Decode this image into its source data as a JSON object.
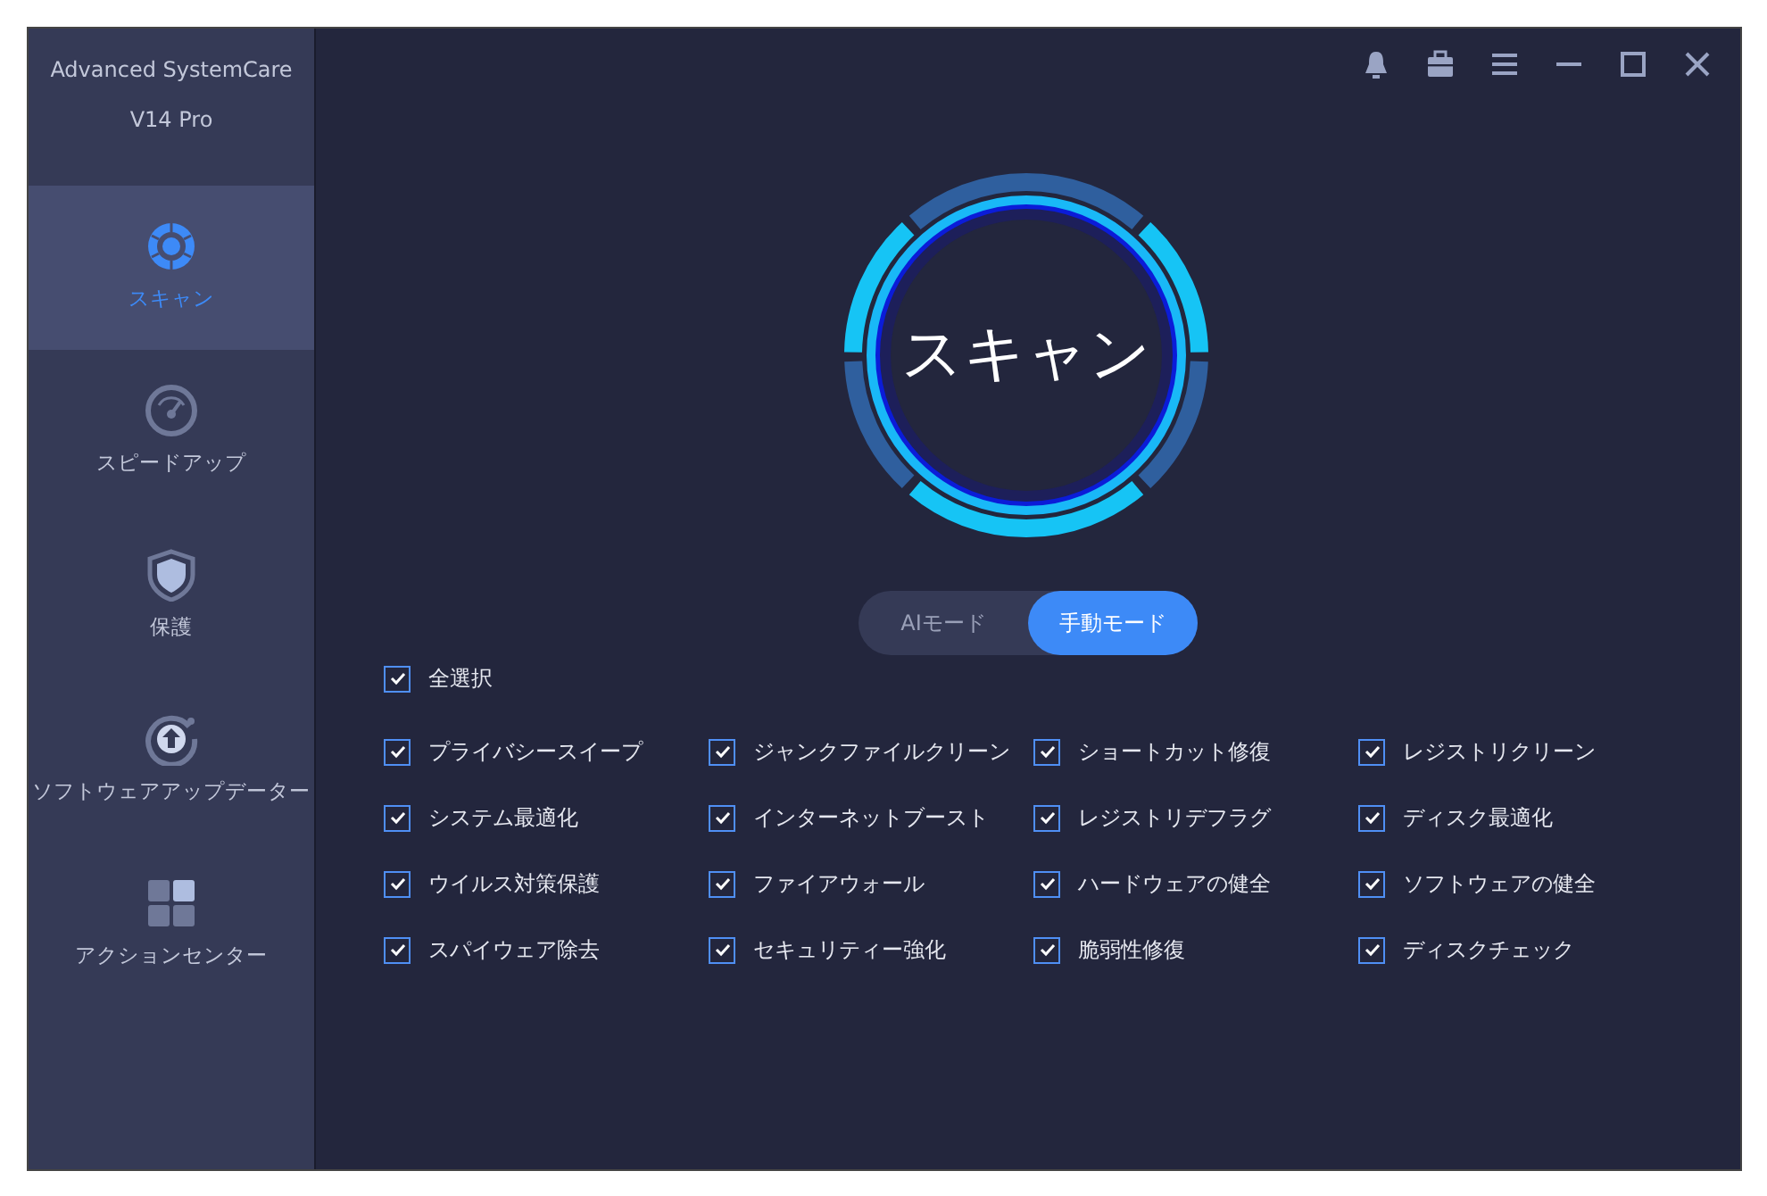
{
  "app": {
    "title": "Advanced SystemCare",
    "version": "V14 Pro"
  },
  "sidebar": {
    "items": [
      {
        "label": "スキャン",
        "selected": true
      },
      {
        "label": "スピードアップ",
        "selected": false
      },
      {
        "label": "保護",
        "selected": false
      },
      {
        "label": "ソフトウェアアップデーター",
        "selected": false
      },
      {
        "label": "アクションセンター",
        "selected": false
      }
    ]
  },
  "scan_button": {
    "label": "スキャン"
  },
  "modes": [
    {
      "label": "AIモード",
      "selected": false
    },
    {
      "label": "手動モード",
      "selected": true
    }
  ],
  "select_all": {
    "label": "全選択",
    "checked": true
  },
  "options": [
    {
      "label": "プライバシースイープ",
      "checked": true
    },
    {
      "label": "ジャンクファイルクリーン",
      "checked": true
    },
    {
      "label": "ショートカット修復",
      "checked": true
    },
    {
      "label": "レジストリクリーン",
      "checked": true
    },
    {
      "label": "システム最適化",
      "checked": true
    },
    {
      "label": "インターネットブースト",
      "checked": true
    },
    {
      "label": "レジストリデフラグ",
      "checked": true
    },
    {
      "label": "ディスク最適化",
      "checked": true
    },
    {
      "label": "ウイルス対策保護",
      "checked": true
    },
    {
      "label": "ファイアウォール",
      "checked": true
    },
    {
      "label": "ハードウェアの健全",
      "checked": true
    },
    {
      "label": "ソフトウェアの健全",
      "checked": true
    },
    {
      "label": "スパイウェア除去",
      "checked": true
    },
    {
      "label": "セキュリティー強化",
      "checked": true
    },
    {
      "label": "脆弱性修復",
      "checked": true
    },
    {
      "label": "ディスクチェック",
      "checked": true
    }
  ]
}
